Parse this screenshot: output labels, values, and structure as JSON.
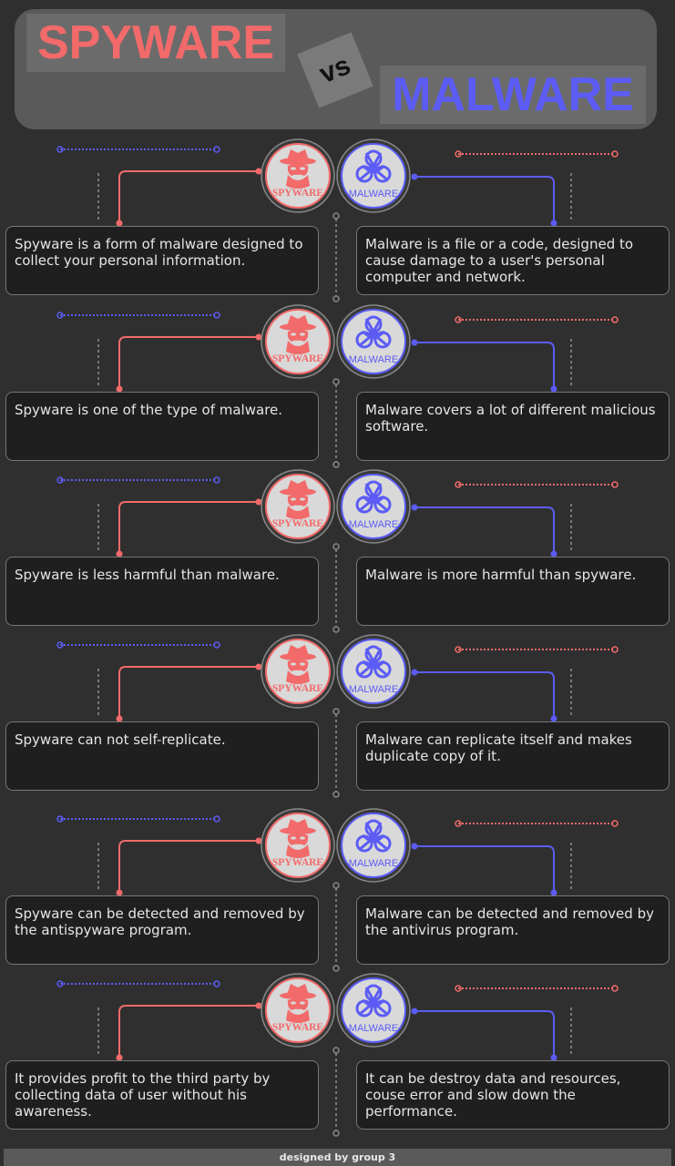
{
  "header": {
    "title_left": "SPYWARE",
    "vs": "vs",
    "title_right": "MALWARE"
  },
  "colors": {
    "spyware": "#f26a6a",
    "malware": "#5c5cf5",
    "background": "#2f2f2f",
    "card": "#1f1f1f"
  },
  "icons": {
    "spyware_label": "SPYWARE",
    "malware_label": "MALWARE",
    "spyware_icon": "spy-hat-icon",
    "malware_icon": "biohazard-icon"
  },
  "rows": [
    {
      "spyware": "Spyware is a form of malware designed to collect your personal information.",
      "malware": "Malware is a file or a code, designed to cause damage to a user's personal computer and network."
    },
    {
      "spyware": "Spyware is one of the type of malware.",
      "malware": "Malware covers a lot of different malicious software."
    },
    {
      "spyware": "Spyware is less harmful than malware.",
      "malware": "Malware is more harmful than spyware."
    },
    {
      "spyware": "Spyware can not self-replicate.",
      "malware": "Malware can replicate itself and makes duplicate copy of it."
    },
    {
      "spyware": "Spyware can be detected and removed by the antispyware program.",
      "malware": "Malware can be detected and removed by the antivirus program."
    },
    {
      "spyware": "It provides profit to the third party by collecting data of user without his awareness.",
      "malware": "It can be destroy data and resources, couse error and slow down the performance."
    }
  ],
  "footer": {
    "credit": "designed by group 3"
  }
}
